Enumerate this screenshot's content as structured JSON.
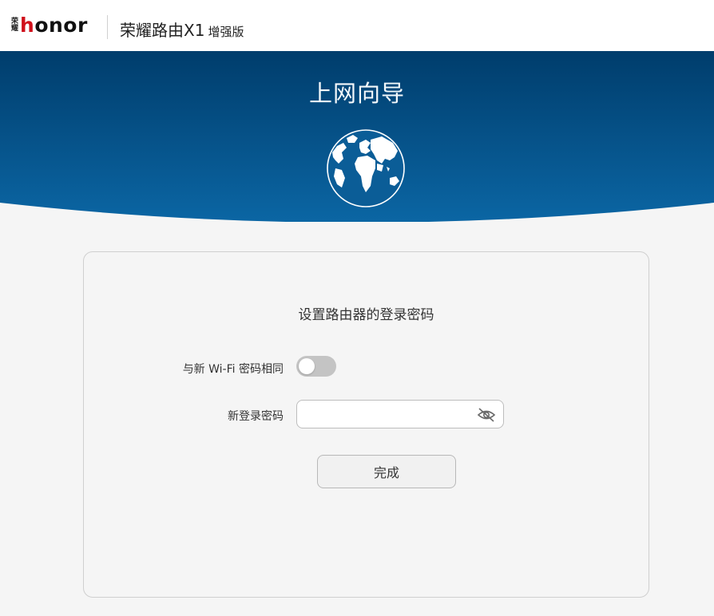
{
  "header": {
    "brand_cn_top": "荣",
    "brand_cn_bottom": "耀",
    "brand_en_first": "h",
    "brand_en_rest": "onor",
    "product_name": "荣耀路由X1",
    "product_edition": "增强版"
  },
  "banner": {
    "title": "上网向导",
    "icon": "globe-icon",
    "gradient_top": "#003e6e",
    "gradient_bottom": "#0a63a0"
  },
  "form": {
    "title": "设置路由器的登录密码",
    "same_as_wifi_label": "与新 Wi-Fi 密码相同",
    "same_as_wifi_toggle": false,
    "new_password_label": "新登录密码",
    "new_password_value": "",
    "new_password_placeholder": "",
    "eye_icon": "eye-hidden-icon",
    "submit_label": "完成"
  },
  "colors": {
    "brand_red": "#d0101b",
    "banner_blue": "#0a5c94",
    "page_bg": "#f5f5f5",
    "toggle_off": "#c4c4c4"
  }
}
